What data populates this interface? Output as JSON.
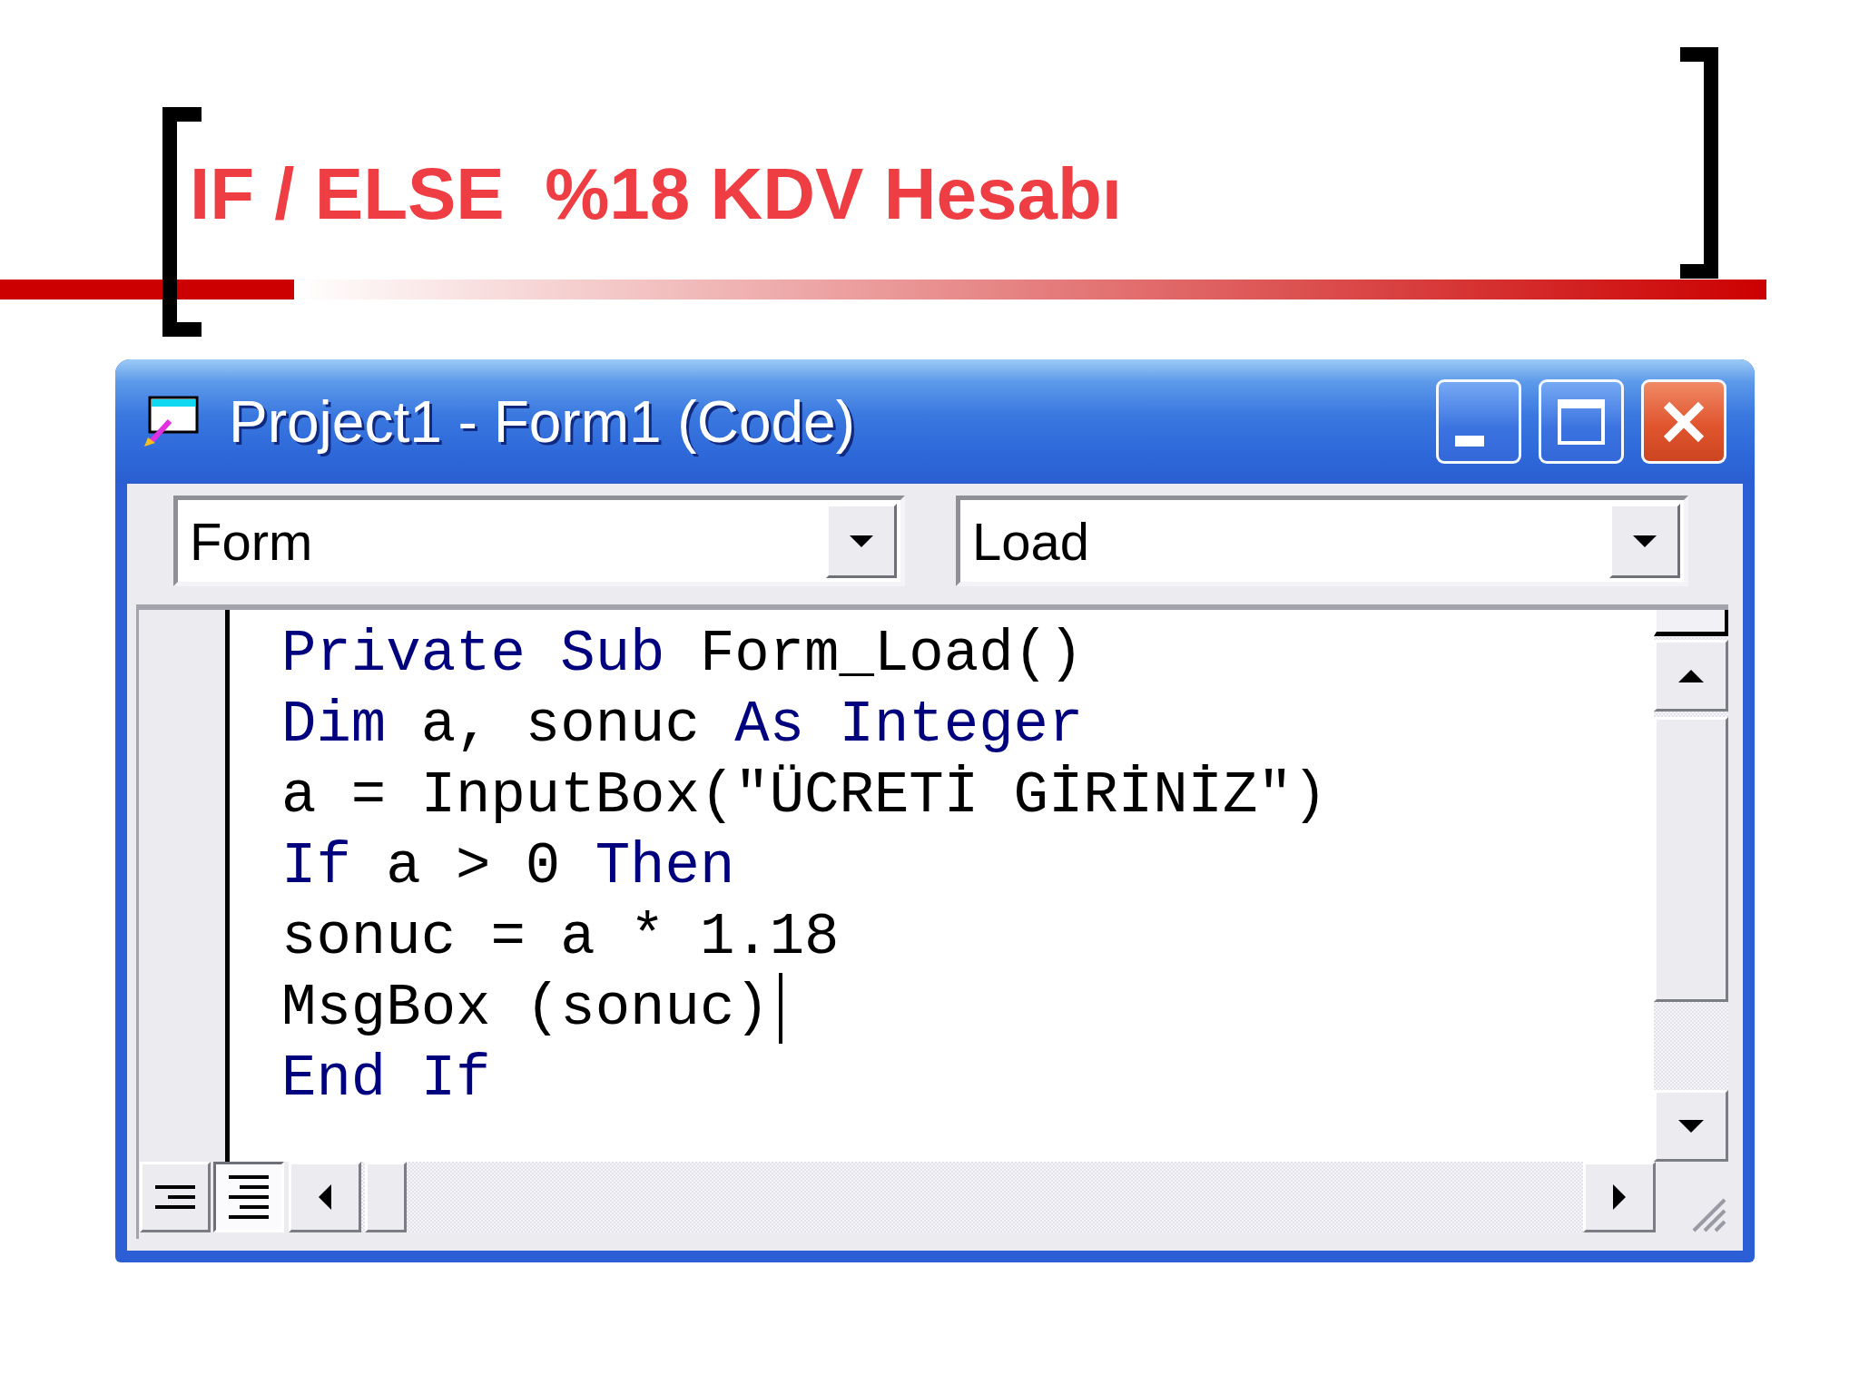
{
  "slide": {
    "title": "IF / ELSE  %18 KDV Hesabı"
  },
  "window": {
    "title": "Project1 - Form1 (Code)"
  },
  "object_box": {
    "value": "Form"
  },
  "procedure_box": {
    "value": "Load"
  },
  "code": {
    "lines": [
      {
        "tokens": [
          {
            "kind": "keyword",
            "text": "Private Sub"
          },
          {
            "kind": "plain",
            "text": " Form_Load()"
          }
        ],
        "cursor": false
      },
      {
        "tokens": [
          {
            "kind": "keyword",
            "text": "Dim"
          },
          {
            "kind": "plain",
            "text": " a, sonuc "
          },
          {
            "kind": "keyword",
            "text": "As Integer"
          }
        ],
        "cursor": false
      },
      {
        "tokens": [
          {
            "kind": "plain",
            "text": "a = InputBox(\"ÜCRETİ GİRİNİZ\")"
          }
        ],
        "cursor": false
      },
      {
        "tokens": [
          {
            "kind": "keyword",
            "text": "If"
          },
          {
            "kind": "plain",
            "text": " a > 0 "
          },
          {
            "kind": "keyword",
            "text": "Then"
          }
        ],
        "cursor": false
      },
      {
        "tokens": [
          {
            "kind": "plain",
            "text": "sonuc = a * 1.18"
          }
        ],
        "cursor": false
      },
      {
        "tokens": [
          {
            "kind": "plain",
            "text": "MsgBox (sonuc)"
          }
        ],
        "cursor": true
      },
      {
        "tokens": [
          {
            "kind": "keyword",
            "text": "End If"
          }
        ],
        "cursor": false
      }
    ]
  },
  "view_buttons": [
    {
      "kind": "procedure",
      "selected": false
    },
    {
      "kind": "module",
      "selected": true
    }
  ]
}
